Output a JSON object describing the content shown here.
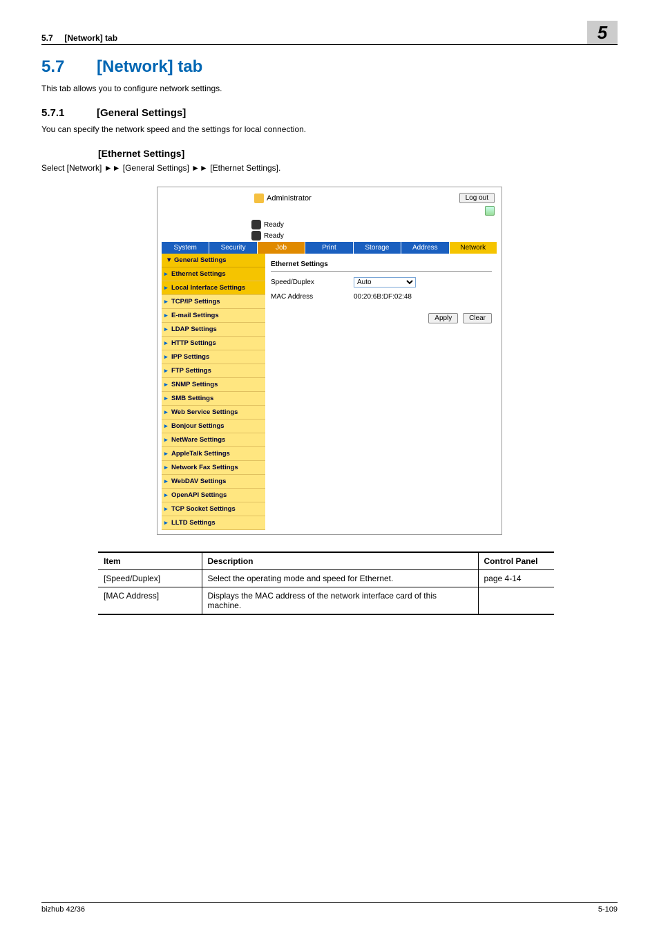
{
  "header": {
    "section_ref": "5.7",
    "section_tab": "[Network] tab",
    "chapter_num": "5"
  },
  "title": {
    "num": "5.7",
    "text": "[Network] tab"
  },
  "intro": "This tab allows you to configure network settings.",
  "sub": {
    "num": "5.7.1",
    "text": "[General Settings]"
  },
  "sub_intro": "You can specify the network speed and the settings for local connection.",
  "eth_heading": "[Ethernet Settings]",
  "eth_path": "Select [Network] ►► [General Settings] ►► [Ethernet Settings].",
  "shot": {
    "admin": "Administrator",
    "logout": "Log out",
    "ready": "Ready",
    "tabs": [
      "System",
      "Security",
      "Job",
      "Print",
      "Storage",
      "Address",
      "Network"
    ],
    "side_header": "▼ General Settings",
    "side_items": [
      "Ethernet Settings",
      "Local Interface Settings",
      "TCP/IP Settings",
      "E-mail Settings",
      "LDAP Settings",
      "HTTP Settings",
      "IPP Settings",
      "FTP Settings",
      "SNMP Settings",
      "SMB Settings",
      "Web Service Settings",
      "Bonjour Settings",
      "NetWare Settings",
      "AppleTalk Settings",
      "Network Fax Settings",
      "WebDAV Settings",
      "OpenAPI Settings",
      "TCP Socket Settings",
      "LLTD Settings"
    ],
    "pane_title": "Ethernet Settings",
    "speed_label": "Speed/Duplex",
    "speed_value": "Auto",
    "mac_label": "MAC Address",
    "mac_value": "00:20:6B:DF:02:48",
    "apply": "Apply",
    "clear": "Clear"
  },
  "table": {
    "headers": [
      "Item",
      "Description",
      "Control Panel"
    ],
    "rows": [
      {
        "item": "[Speed/Duplex]",
        "desc": "Select the operating mode and speed for Ethernet.",
        "cp": "page 4-14"
      },
      {
        "item": "[MAC Address]",
        "desc": "Displays the MAC address of the network interface card of this machine.",
        "cp": ""
      }
    ]
  },
  "footer": {
    "model": "bizhub 42/36",
    "page": "5-109"
  }
}
